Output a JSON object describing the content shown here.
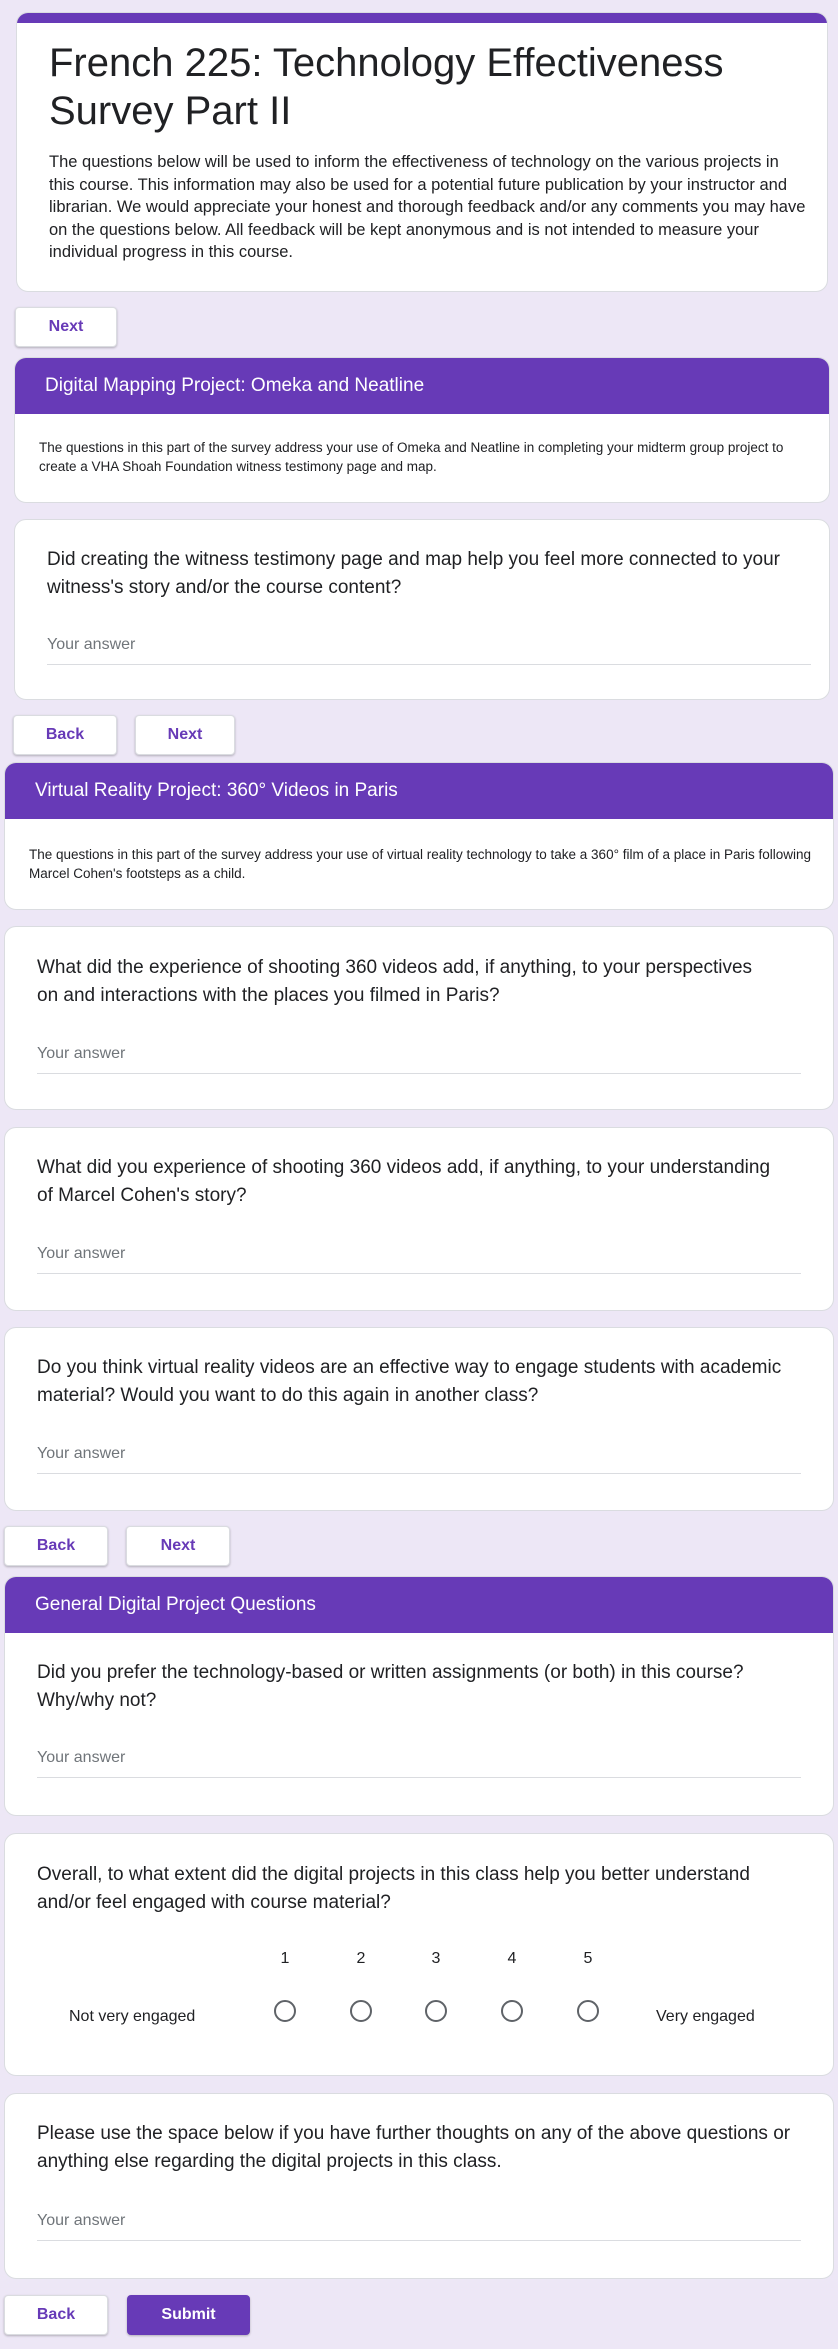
{
  "form": {
    "title": "French 225: Technology Effectiveness Survey Part II",
    "description": "The questions below will be used to inform the effectiveness of technology on the various projects in this course. This information may also be used for a potential future publication by your instructor and librarian. We would appreciate your honest and thorough feedback and/or any comments you may have on the questions below. All feedback will be kept anonymous and is not intended to measure your individual progress in this course."
  },
  "buttons": {
    "next": "Next",
    "back": "Back",
    "submit": "Submit"
  },
  "answer_placeholder": "Your answer",
  "sections": [
    {
      "title": "Digital Mapping Project: Omeka and Neatline",
      "description": "The questions in this part of the survey address your use of Omeka and Neatline in completing your midterm group project to create a VHA Shoah Foundation witness testimony page and map.",
      "questions": [
        "Did creating the witness testimony page and map help you feel more connected to your witness's story and/or the course content?"
      ]
    },
    {
      "title": "Virtual Reality Project: 360° Videos in Paris",
      "description": "The questions in this part of the survey address your use of virtual reality technology to take a 360° film of a place in Paris  following Marcel Cohen's footsteps as a child.",
      "questions": [
        "What did the experience of shooting 360 videos add, if anything, to your perspectives on and interactions with the places you filmed in Paris?",
        "What did you experience of shooting 360 videos add, if anything, to your understanding of Marcel Cohen's story?",
        "Do you think virtual reality videos are an effective way to engage students with academic material? Would you want to do this again in another class?"
      ]
    },
    {
      "title": "General Digital Project Questions",
      "questions": [
        "Did you prefer the technology-based or written assignments (or both) in this course? Why/why not?",
        "Overall, to what extent did the digital projects in this class help you better understand and/or feel engaged with course material?",
        "Please use the space below if you have further thoughts on any of the above questions or anything else regarding the digital projects in this class."
      ]
    }
  ],
  "scale": {
    "numbers": [
      "1",
      "2",
      "3",
      "4",
      "5"
    ],
    "low_label": "Not very engaged",
    "high_label": "Very engaged"
  },
  "colors": {
    "accent": "#673ab7",
    "background": "#ede7f6"
  }
}
